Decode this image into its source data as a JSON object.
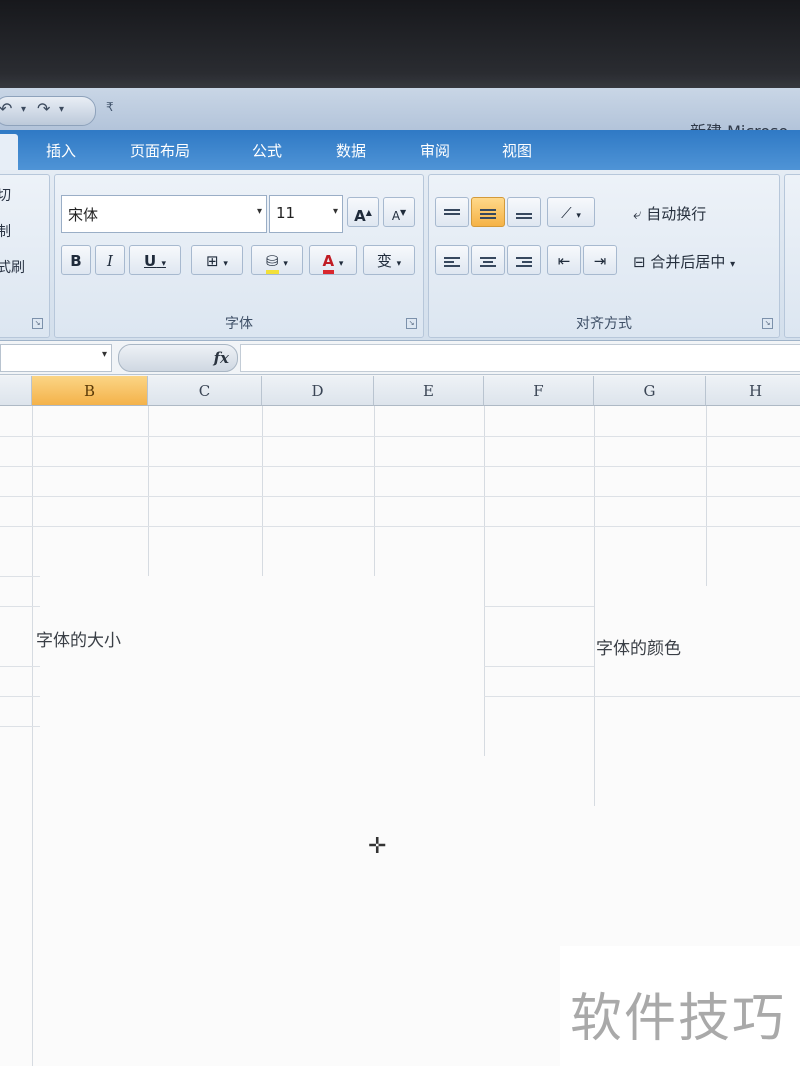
{
  "quick_access": {
    "undo_icon": "undo-icon",
    "redo_icon": "redo-icon",
    "more": "₹"
  },
  "title": "新建 Microso",
  "tabs": [
    "插入",
    "页面布局",
    "公式",
    "数据",
    "审阅",
    "视图"
  ],
  "clipboard": {
    "items": [
      "切",
      "制",
      "式刷"
    ]
  },
  "font_group": {
    "label": "字体",
    "font_name": "宋体",
    "font_size": "11",
    "grow": "A",
    "shrink": "A",
    "bold": "B",
    "italic": "I",
    "underline": "U",
    "font_color": "A",
    "phonetic": "变"
  },
  "align_group": {
    "label": "对齐方式",
    "wrap_text": "自动换行",
    "merge_center": "合并后居中"
  },
  "formula_bar": {
    "fx": "fx"
  },
  "columns": [
    "B",
    "C",
    "D",
    "E",
    "F",
    "G",
    "H"
  ],
  "selected_column": "B",
  "cells": {
    "b_text": "字体的大小",
    "g_text": "字体的颜色"
  },
  "watermark": "软件技巧",
  "colors": {
    "tab_bar": "#3c86cf",
    "selected_header": "#f4b24a",
    "font_color_bar": "#d9272e",
    "fill_color_bar": "#f2e03a"
  }
}
